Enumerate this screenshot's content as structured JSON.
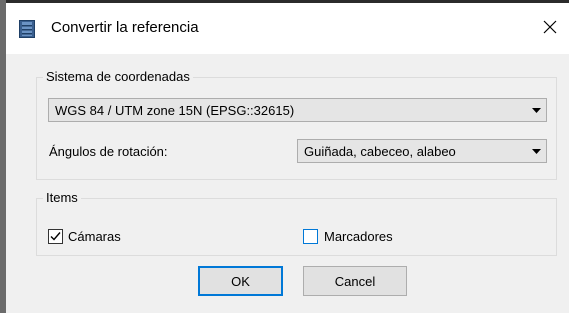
{
  "window": {
    "title": "Convertir la referencia",
    "close_label": "Close"
  },
  "coordinate_group": {
    "legend": "Sistema de coordenadas",
    "crs_value": "WGS 84 / UTM zone 15N (EPSG::32615)",
    "rotation_label": "Ángulos de rotación:",
    "rotation_value": "Guiñada, cabeceo, alabeo"
  },
  "items_group": {
    "legend": "Items",
    "cameras_label": "Cámaras",
    "cameras_checked": true,
    "markers_label": "Marcadores",
    "markers_checked": false
  },
  "buttons": {
    "ok_label": "OK",
    "cancel_label": "Cancel"
  },
  "colors": {
    "accent": "#0078d7",
    "dialog_bg": "#f0f0f0"
  },
  "icons": [
    "app-icon",
    "close-icon",
    "dropdown-arrow-icon",
    "checkmark-icon"
  ]
}
